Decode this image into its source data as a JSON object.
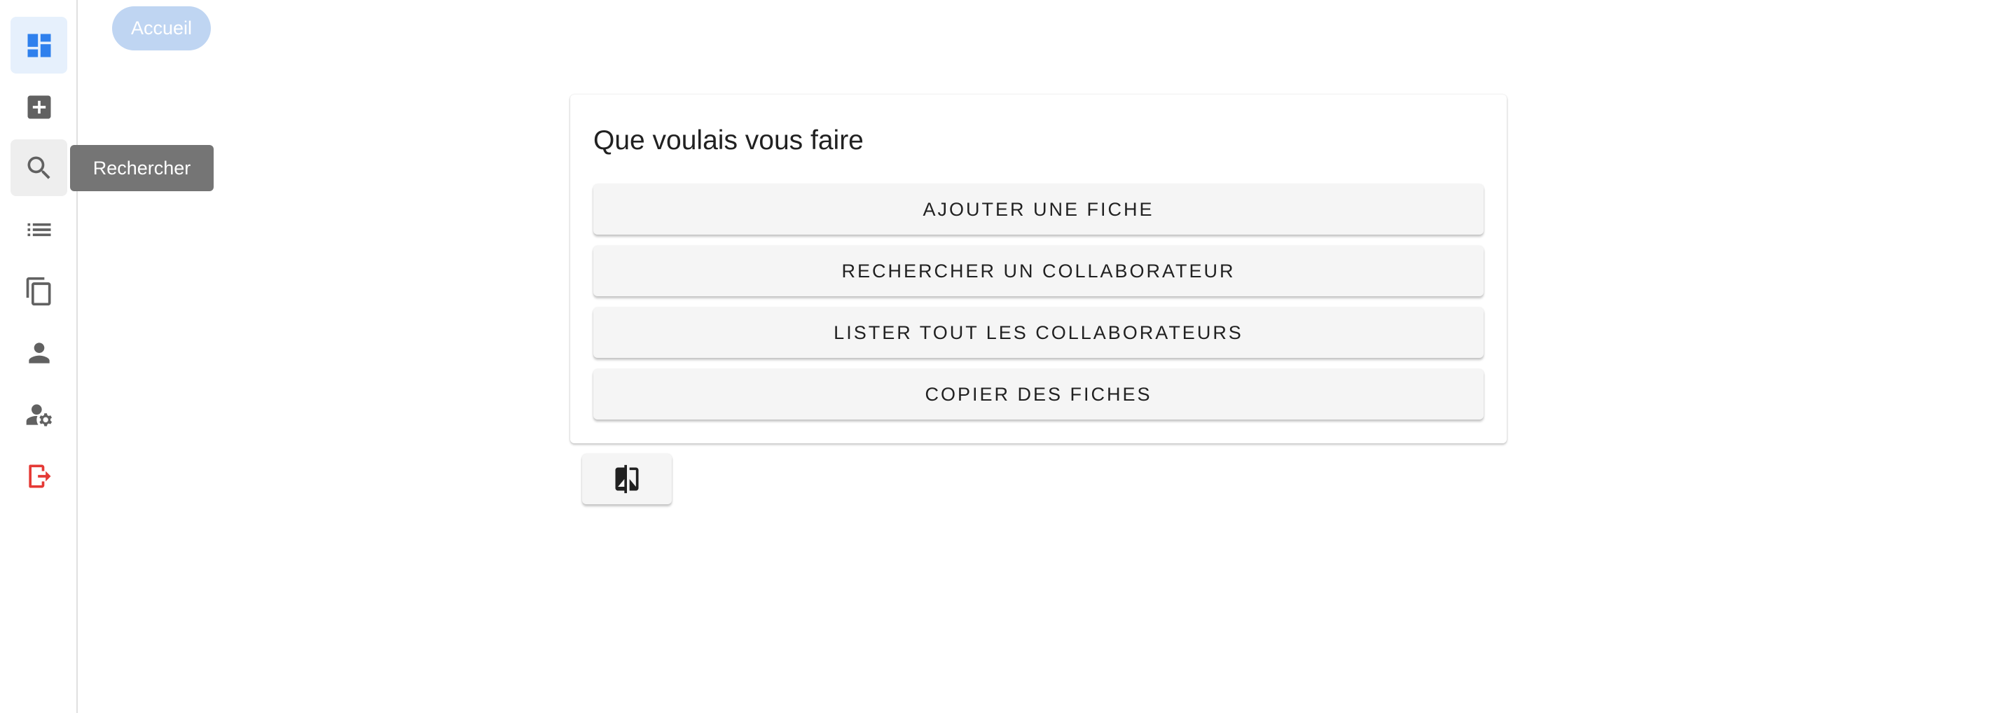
{
  "breadcrumb": {
    "label": "Accueil"
  },
  "sidebar": {
    "items": [
      {
        "icon": "dashboard-icon",
        "active": true
      },
      {
        "icon": "add-box-icon"
      },
      {
        "icon": "search-icon",
        "hover": true
      },
      {
        "icon": "list-icon"
      },
      {
        "icon": "copy-icon"
      },
      {
        "icon": "person-icon"
      },
      {
        "icon": "manage-accounts-icon"
      },
      {
        "icon": "logout-icon"
      }
    ],
    "tooltip": "Rechercher"
  },
  "card": {
    "title": "Que voulais vous faire",
    "actions": [
      {
        "label": "AJOUTER UNE FICHE"
      },
      {
        "label": "RECHERCHER UN COLLABORATEUR"
      },
      {
        "label": "LISTER TOUT LES COLLABORATEURS"
      },
      {
        "label": "COPIER DES FICHES"
      }
    ]
  },
  "swap_button": {
    "icon": "compare-icon"
  },
  "colors": {
    "active_icon": "#2f80ed",
    "default_icon": "#616161",
    "logout_icon": "#e53935",
    "active_bg": "#e6f0fc",
    "chip_bg": "#bfd5f2",
    "tooltip_bg": "#757575"
  }
}
